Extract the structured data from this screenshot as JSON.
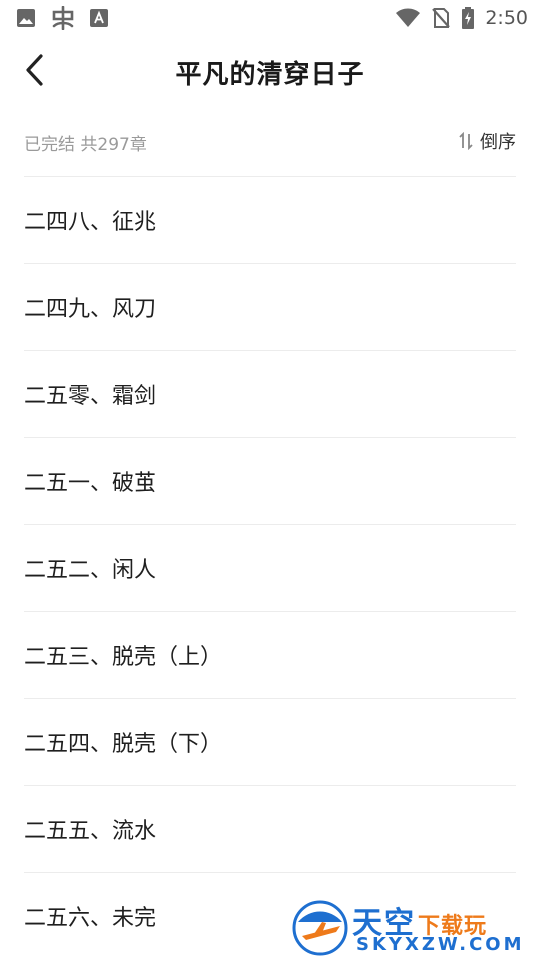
{
  "status_bar": {
    "time": "2:50",
    "left_icons": [
      "image-icon",
      "bug-icon",
      "text-a-icon"
    ],
    "right_icons": [
      "wifi-icon",
      "no-sim-icon",
      "battery-charging-icon"
    ]
  },
  "header": {
    "title": "平凡的清穿日子",
    "back_icon": "chevron-left-icon"
  },
  "info": {
    "status_text": "已完结 共297章",
    "sort_label": "倒序",
    "sort_icon": "sort-arrows-icon"
  },
  "chapters": [
    {
      "title": "二四八、征兆"
    },
    {
      "title": "二四九、风刀"
    },
    {
      "title": "二五零、霜剑"
    },
    {
      "title": "二五一、破茧"
    },
    {
      "title": "二五二、闲人"
    },
    {
      "title": "二五三、脱壳（上）"
    },
    {
      "title": "二五四、脱壳（下）"
    },
    {
      "title": "二五五、流水"
    },
    {
      "title": "二五六、未完"
    }
  ],
  "watermark": {
    "cn_main": "天空",
    "cn_sub": "下载玩",
    "en": "SKYXZW.COM",
    "colors": {
      "blue": "#1e6fd0",
      "orange": "#ee7a1a"
    }
  }
}
